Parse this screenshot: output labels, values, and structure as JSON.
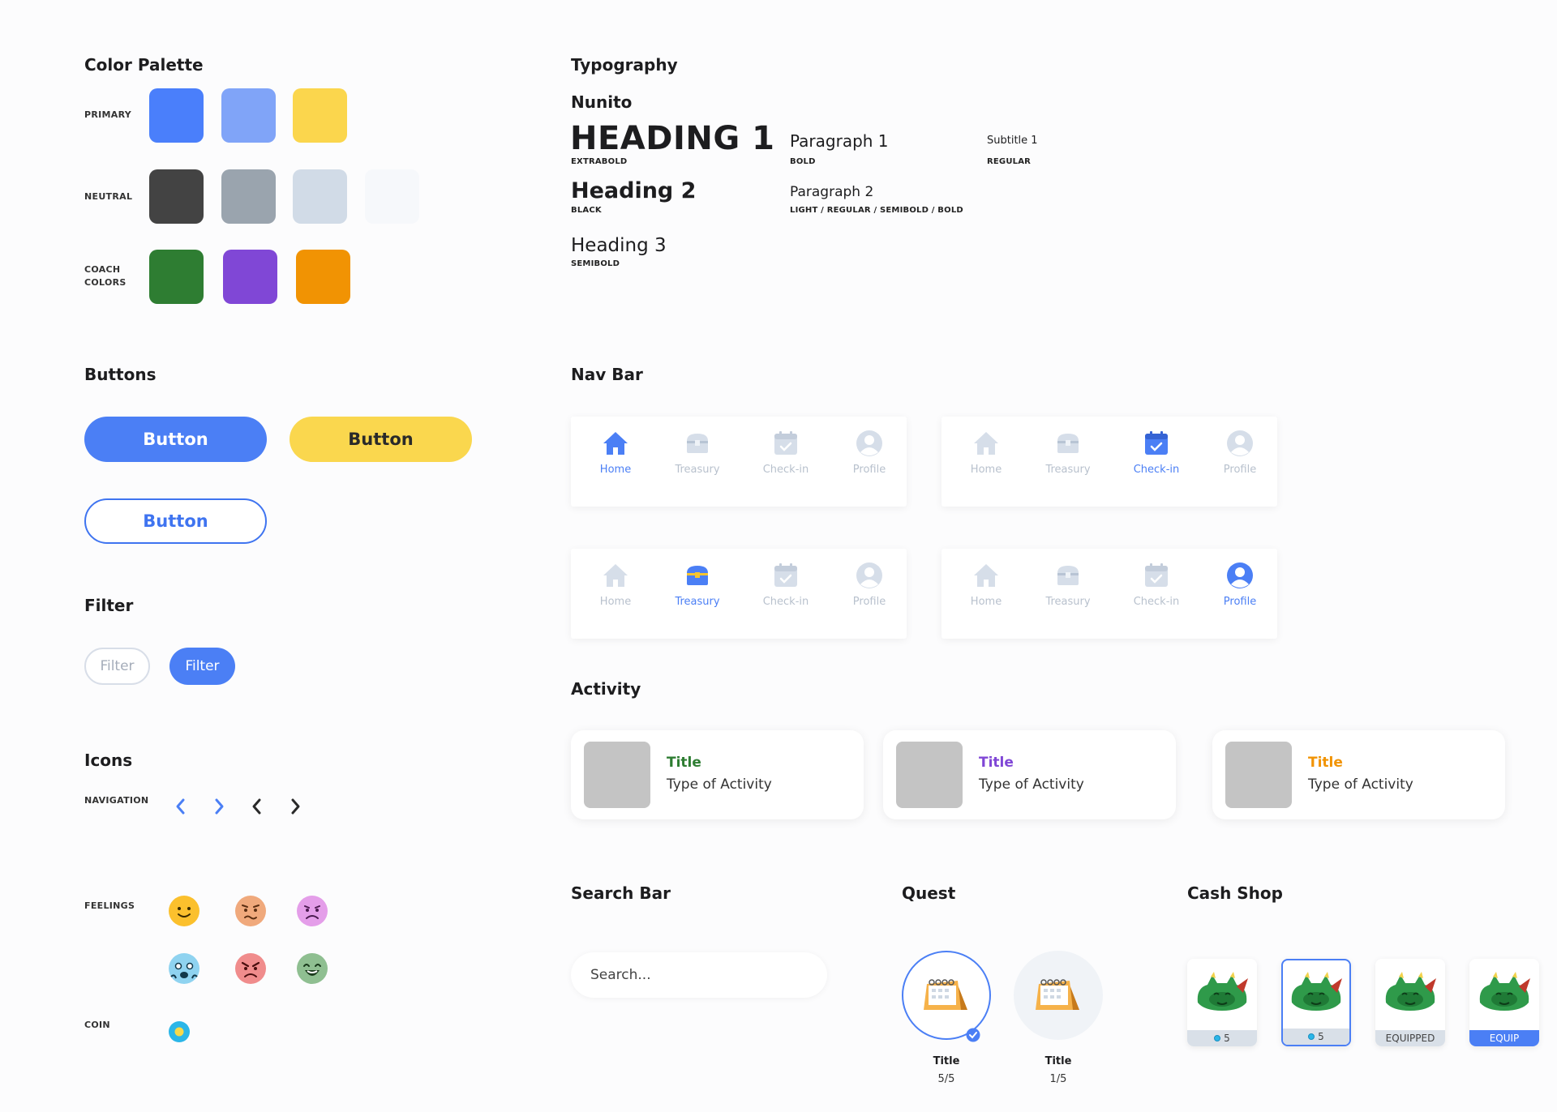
{
  "colors": {
    "primary": [
      "#4a7ffb",
      "#80a4f8",
      "#fbd64d"
    ],
    "neutral": [
      "#434343",
      "#9aa4ae",
      "#d1dbe7",
      "#f6f8fb"
    ],
    "coach": [
      "#2e7d32",
      "#8047d6",
      "#f19303"
    ],
    "blue": "#4b7ff5"
  },
  "palette": {
    "title": "Color Palette",
    "primary_label": "PRIMARY",
    "neutral_label": "NEUTRAL",
    "coach_label_1": "COACH",
    "coach_label_2": "COLORS"
  },
  "typography": {
    "title": "Typography",
    "font_name": "Nunito",
    "h1": "HEADING 1",
    "h1_weight": "EXTRABOLD",
    "h2": "Heading 2",
    "h2_weight": "BLACK",
    "h3": "Heading 3",
    "h3_weight": "SEMIBOLD",
    "p1": "Paragraph 1",
    "p1_weight": "BOLD",
    "p2": "Paragraph 2",
    "p2_weight": "LIGHT / REGULAR / SEMIBOLD / BOLD",
    "s1": "Subtitle 1",
    "s1_weight": "REGULAR"
  },
  "buttons": {
    "title": "Buttons",
    "primary_label": "Button",
    "yellow_label": "Button",
    "outline_label": "Button"
  },
  "filter": {
    "title": "Filter",
    "inactive_label": "Filter",
    "active_label": "Filter"
  },
  "icons": {
    "title": "Icons",
    "navigation_label": "NAVIGATION",
    "feelings_label": "FEELINGS",
    "coin_label": "COIN",
    "nav_icons": [
      "chevron-left-icon",
      "chevron-right-icon",
      "chevron-left-icon",
      "chevron-right-icon"
    ],
    "feelings": [
      "happy-face-icon",
      "worried-face-icon",
      "sad-face-icon",
      "anxious-face-icon",
      "angry-face-icon",
      "laughing-face-icon"
    ]
  },
  "navbar": {
    "title": "Nav Bar",
    "items": [
      "Home",
      "Treasury",
      "Check-in",
      "Profile"
    ],
    "active_states": [
      "Home",
      "Check-in",
      "Treasury",
      "Profile"
    ]
  },
  "activity": {
    "title": "Activity",
    "cards": [
      {
        "title": "Title",
        "type": "Type of Activity",
        "color": "#2e7d32"
      },
      {
        "title": "Title",
        "type": "Type of Activity",
        "color": "#8047d6"
      },
      {
        "title": "Title",
        "type": "Type of Activity",
        "color": "#f19303"
      }
    ]
  },
  "search": {
    "title": "Search Bar",
    "placeholder": "Search..."
  },
  "quest": {
    "title": "Quest",
    "items": [
      {
        "title": "Title",
        "progress": "5/5"
      },
      {
        "title": "Title",
        "progress": "1/5"
      }
    ]
  },
  "cashshop": {
    "title": "Cash Shop",
    "items": [
      {
        "footer": "5"
      },
      {
        "footer": "5"
      },
      {
        "footer": "EQUIPPED"
      },
      {
        "footer": "EQUIP"
      }
    ]
  }
}
